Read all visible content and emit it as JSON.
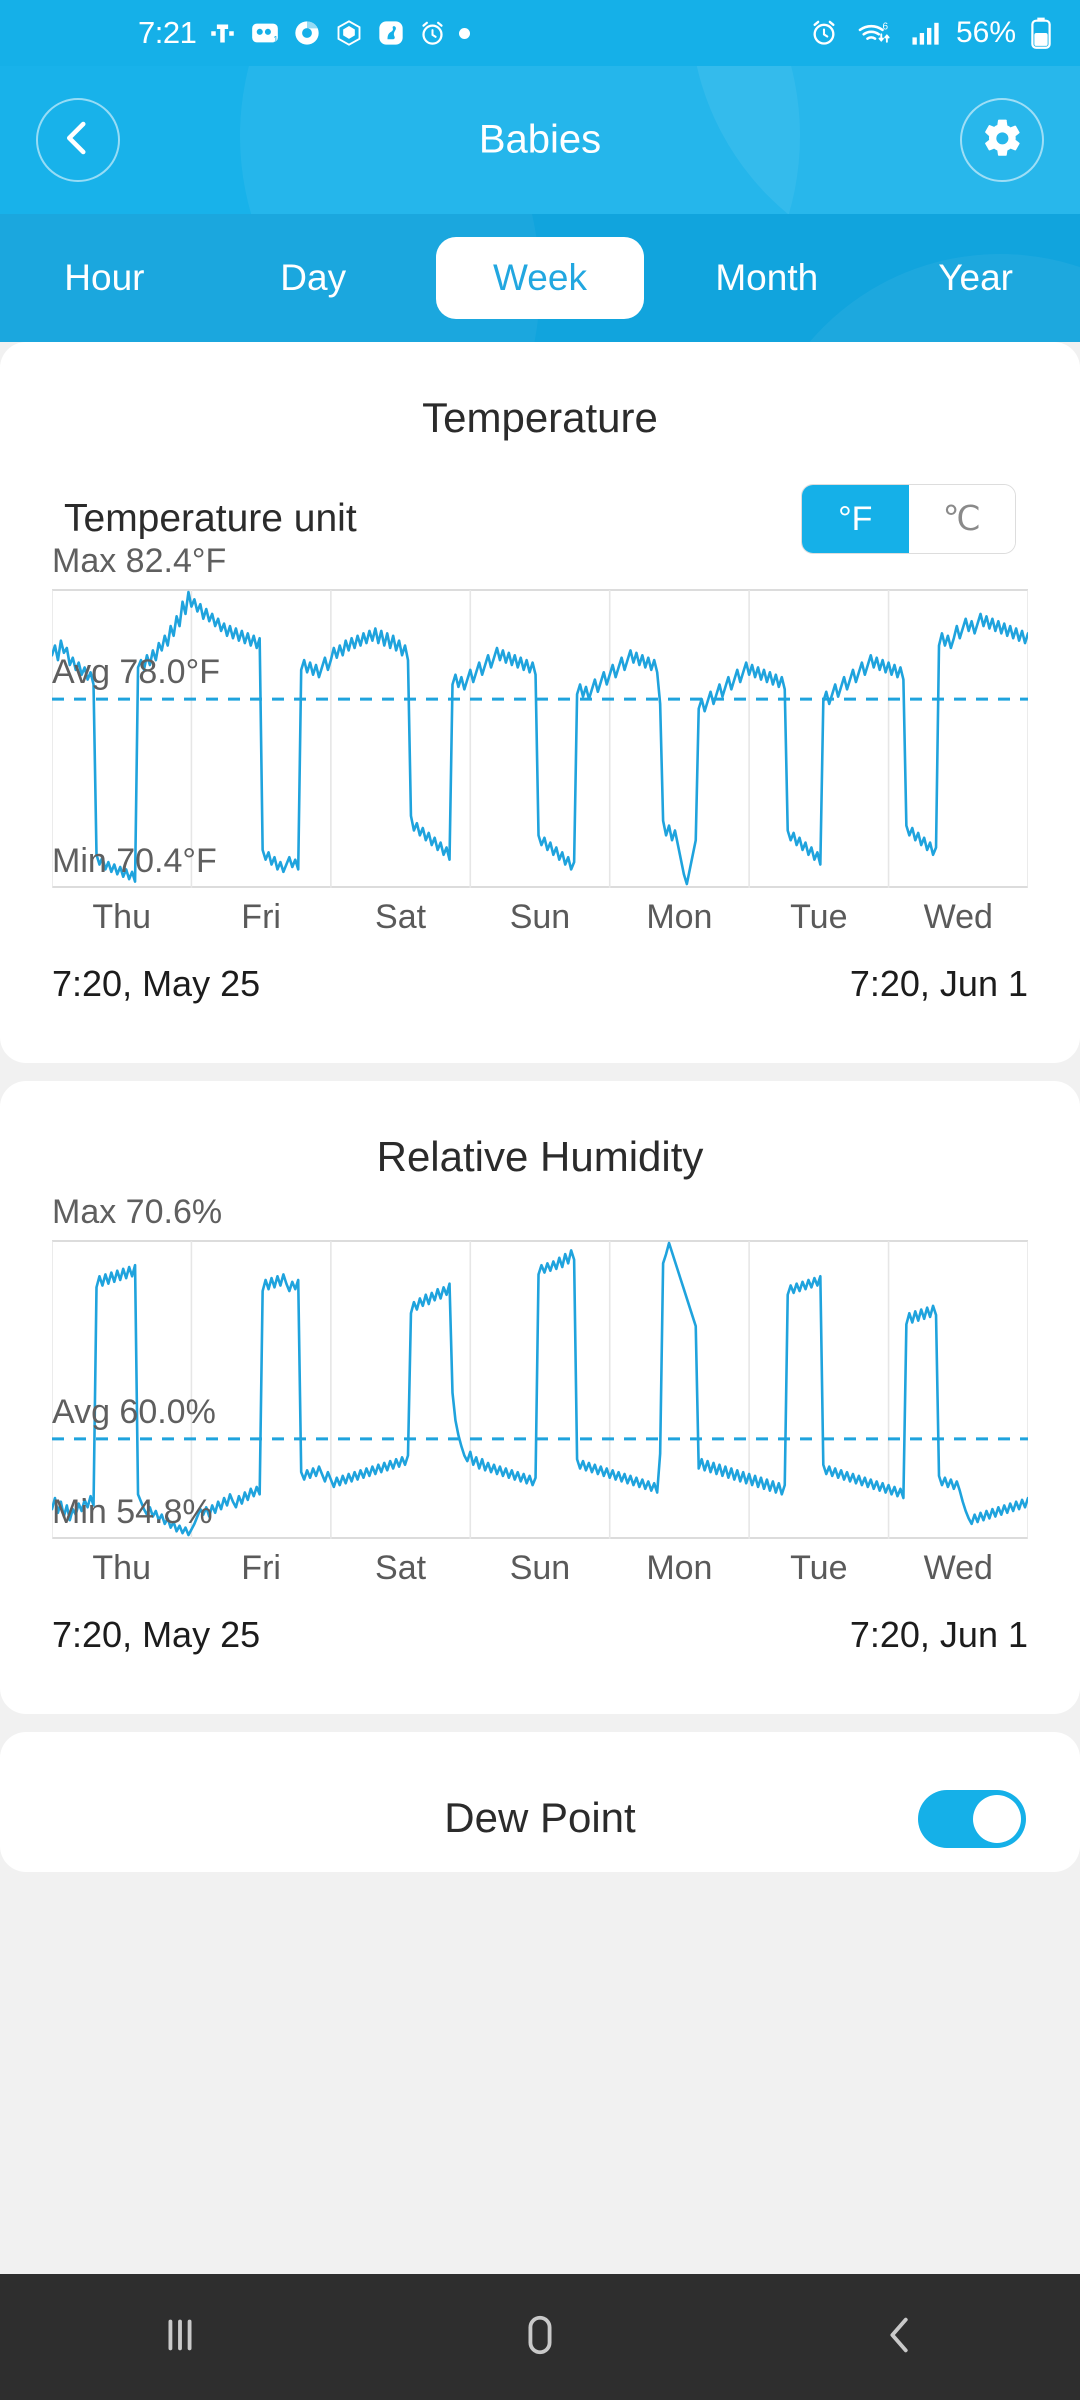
{
  "status_bar": {
    "time": "7:21",
    "carrier_icon": "t-mobile-icon",
    "icons": [
      "voicemail-icon",
      "chrome-icon",
      "crypto-icon",
      "squirrel-app-icon",
      "alarm-icon",
      "dot-indicator-icon"
    ],
    "alarm_icon": "alarm-icon",
    "wifi_icon": "wifi-icon",
    "signal_icon": "cellular-signal-icon",
    "battery_percent": "56%",
    "battery_icon": "battery-icon"
  },
  "app_bar": {
    "back_icon": "chevron-left-icon",
    "title": "Babies",
    "settings_icon": "gear-icon"
  },
  "tabs": [
    {
      "label": "Hour",
      "active": false
    },
    {
      "label": "Day",
      "active": false
    },
    {
      "label": "Week",
      "active": true
    },
    {
      "label": "Month",
      "active": false
    },
    {
      "label": "Year",
      "active": false
    }
  ],
  "temperature_card": {
    "title": "Temperature",
    "unit_label": "Temperature unit",
    "unit_fahrenheit": "°F",
    "unit_celsius": "℃",
    "selected_unit": "°F",
    "max_label": "Max 82.4°F",
    "avg_label": "Avg 78.0°F",
    "min_label": "Min 70.4°F",
    "start_datetime": "7:20,  May 25",
    "end_datetime": "7:20,  Jun 1"
  },
  "humidity_card": {
    "title": "Relative Humidity",
    "max_label": "Max 70.6%",
    "avg_label": "Avg 60.0%",
    "min_label": "Min 54.8%",
    "start_datetime": "7:20,  May 25",
    "end_datetime": "7:20,  Jun 1"
  },
  "dew_point_card": {
    "title": "Dew Point",
    "toggle_on": true
  },
  "nav_bar": {
    "recents_icon": "recents-icon",
    "home_icon": "home-icon",
    "back_icon": "back-icon"
  },
  "colors": {
    "accent": "#15b0e8",
    "header": "#18b2ea",
    "tabbar": "#11a4dd",
    "series": "#1fa3dd",
    "page_bg": "#f1f1f1",
    "navbar": "#2e2e2e"
  },
  "chart_data": [
    {
      "type": "line",
      "title": "Temperature",
      "xlabel": "",
      "ylabel": "°F",
      "ylim": [
        70.4,
        82.4
      ],
      "max": 82.4,
      "avg": 78.0,
      "min": 70.4,
      "unit": "°F",
      "grid": true,
      "legend": "none",
      "avg_line": 78.0,
      "categories": [
        "Thu",
        "Fri",
        "Sat",
        "Sun",
        "Mon",
        "Tue",
        "Wed"
      ],
      "x_start": "7:20,  May 25",
      "x_end": "7:20,  Jun 1",
      "values": [
        79.8,
        80.2,
        79.6,
        80.4,
        79.9,
        80.1,
        79.4,
        79.7,
        79.2,
        79.5,
        79.0,
        79.3,
        78.8,
        79.1,
        78.6,
        71.6,
        71.2,
        71.5,
        71.0,
        71.3,
        70.9,
        71.2,
        70.8,
        71.1,
        70.7,
        71.0,
        70.6,
        70.9,
        70.5,
        79.3,
        79.6,
        79.2,
        79.8,
        79.4,
        80.0,
        79.6,
        80.3,
        80.0,
        80.6,
        80.2,
        81.0,
        80.6,
        81.4,
        81.0,
        82.0,
        81.5,
        82.4,
        81.8,
        82.1,
        81.6,
        81.9,
        81.3,
        81.7,
        81.2,
        81.5,
        81.0,
        81.3,
        80.8,
        81.1,
        80.6,
        81.0,
        80.5,
        80.9,
        80.4,
        80.8,
        80.3,
        80.7,
        80.2,
        80.6,
        80.1,
        80.5,
        71.8,
        71.4,
        71.7,
        71.2,
        71.5,
        71.0,
        71.3,
        70.9,
        71.2,
        71.5,
        71.1,
        71.4,
        71.0,
        79.2,
        79.6,
        79.1,
        79.5,
        79.0,
        79.4,
        78.9,
        79.3,
        79.7,
        79.2,
        79.6,
        80.1,
        79.7,
        80.2,
        79.8,
        80.4,
        80.0,
        80.5,
        80.1,
        80.6,
        80.2,
        80.7,
        80.3,
        80.8,
        80.4,
        80.9,
        80.3,
        80.8,
        80.2,
        80.7,
        80.1,
        80.6,
        80.0,
        80.4,
        79.8,
        80.2,
        79.6,
        73.2,
        72.6,
        72.9,
        72.4,
        72.7,
        72.2,
        72.5,
        72.0,
        72.3,
        71.8,
        72.1,
        71.6,
        71.9,
        71.4,
        78.6,
        79.0,
        78.5,
        78.9,
        78.4,
        78.8,
        79.2,
        78.7,
        79.1,
        79.5,
        79.0,
        79.4,
        79.8,
        79.3,
        79.7,
        80.1,
        79.6,
        80.0,
        79.5,
        79.9,
        79.4,
        79.8,
        79.3,
        79.7,
        79.2,
        79.6,
        79.1,
        79.5,
        79.0,
        72.4,
        72.0,
        72.3,
        71.8,
        72.1,
        71.6,
        71.9,
        71.4,
        71.7,
        71.2,
        71.5,
        71.0,
        71.3,
        78.2,
        78.6,
        78.1,
        78.5,
        78.0,
        78.4,
        78.8,
        78.3,
        78.7,
        79.1,
        78.6,
        79.0,
        79.4,
        78.9,
        79.3,
        79.7,
        79.2,
        79.6,
        80.0,
        79.5,
        79.9,
        79.4,
        79.8,
        79.3,
        79.7,
        79.2,
        79.6,
        79.1,
        77.8,
        73.0,
        72.4,
        72.8,
        72.2,
        72.6,
        72.0,
        71.4,
        70.8,
        70.4,
        71.0,
        71.6,
        72.2,
        77.6,
        78.0,
        77.5,
        77.9,
        78.3,
        77.8,
        78.2,
        78.6,
        78.1,
        78.5,
        78.9,
        78.4,
        78.8,
        79.2,
        78.7,
        79.1,
        79.5,
        79.0,
        79.4,
        78.9,
        79.3,
        78.8,
        79.2,
        78.7,
        79.1,
        78.6,
        79.0,
        78.5,
        78.9,
        78.4,
        72.6,
        72.2,
        72.5,
        72.0,
        72.3,
        71.8,
        72.1,
        71.6,
        71.9,
        71.4,
        71.7,
        71.2,
        77.9,
        78.3,
        77.8,
        78.2,
        78.6,
        78.1,
        78.5,
        78.9,
        78.4,
        78.8,
        79.2,
        78.7,
        79.1,
        79.5,
        79.0,
        79.4,
        79.8,
        79.3,
        79.7,
        79.2,
        79.6,
        79.1,
        79.5,
        79.0,
        79.4,
        78.9,
        79.3,
        78.8,
        72.8,
        72.4,
        72.7,
        72.2,
        72.5,
        72.0,
        72.3,
        71.8,
        72.1,
        71.6,
        71.9,
        80.2,
        80.7,
        80.2,
        80.6,
        80.1,
        80.5,
        81.0,
        80.5,
        80.9,
        81.3,
        80.8,
        81.2,
        80.7,
        81.1,
        81.5,
        81.0,
        81.4,
        80.9,
        81.3,
        80.8,
        81.2,
        80.7,
        81.1,
        80.6,
        81.0,
        80.5,
        80.9,
        80.4,
        80.8,
        80.3,
        80.7
      ]
    },
    {
      "type": "line",
      "title": "Relative Humidity",
      "xlabel": "",
      "ylabel": "%",
      "ylim": [
        54.8,
        70.6
      ],
      "max": 70.6,
      "avg": 60.0,
      "min": 54.8,
      "unit": "%",
      "grid": true,
      "legend": "none",
      "avg_line": 60.0,
      "categories": [
        "Thu",
        "Fri",
        "Sat",
        "Sun",
        "Mon",
        "Tue",
        "Wed"
      ],
      "x_start": "7:20,  May 25",
      "x_end": "7:20,  Jun 1",
      "values": [
        56.2,
        56.8,
        56.0,
        56.6,
        55.8,
        56.4,
        55.6,
        56.2,
        55.9,
        56.5,
        56.1,
        56.7,
        56.3,
        56.9,
        56.4,
        68.2,
        68.8,
        68.3,
        68.9,
        68.4,
        69.0,
        68.5,
        69.1,
        68.6,
        69.2,
        68.7,
        69.3,
        68.8,
        69.4,
        57.0,
        56.6,
        56.2,
        55.9,
        56.3,
        55.8,
        56.1,
        55.6,
        55.9,
        55.4,
        55.7,
        55.2,
        55.5,
        55.0,
        55.3,
        54.9,
        55.2,
        54.8,
        55.1,
        55.4,
        55.8,
        56.2,
        55.9,
        56.3,
        55.8,
        56.4,
        56.0,
        56.6,
        56.2,
        56.8,
        56.4,
        57.0,
        56.6,
        56.3,
        56.9,
        56.5,
        57.1,
        56.7,
        57.3,
        56.9,
        57.4,
        57.0,
        68.0,
        68.6,
        68.1,
        68.7,
        68.2,
        68.8,
        68.3,
        68.9,
        68.4,
        68.0,
        68.5,
        68.1,
        68.6,
        58.2,
        57.8,
        58.3,
        57.9,
        58.4,
        58.0,
        58.5,
        58.1,
        57.7,
        58.2,
        57.8,
        57.4,
        57.9,
        57.5,
        58.0,
        57.6,
        58.1,
        57.7,
        58.2,
        57.8,
        58.3,
        57.9,
        58.4,
        58.0,
        58.5,
        58.1,
        58.6,
        58.2,
        58.7,
        58.3,
        58.8,
        58.4,
        58.9,
        58.5,
        59.0,
        58.6,
        59.1,
        66.8,
        67.4,
        67.0,
        67.6,
        67.2,
        67.8,
        67.3,
        67.9,
        67.5,
        68.1,
        67.6,
        68.2,
        67.8,
        68.4,
        62.5,
        61.0,
        60.2,
        59.6,
        59.1,
        58.8,
        59.3,
        58.6,
        59.0,
        58.4,
        58.9,
        58.3,
        58.7,
        58.2,
        58.6,
        58.1,
        58.5,
        58.0,
        58.4,
        57.9,
        58.3,
        57.8,
        58.2,
        57.7,
        58.1,
        57.6,
        58.0,
        57.5,
        57.9,
        68.9,
        69.4,
        69.0,
        69.5,
        69.1,
        69.6,
        69.2,
        69.8,
        69.3,
        70.0,
        69.5,
        70.2,
        69.7,
        58.9,
        58.4,
        58.8,
        58.3,
        58.7,
        58.2,
        58.6,
        58.1,
        58.5,
        58.0,
        58.4,
        57.9,
        58.3,
        57.8,
        58.2,
        57.7,
        58.1,
        57.6,
        58.0,
        57.5,
        57.9,
        57.4,
        57.8,
        57.3,
        57.7,
        57.2,
        57.6,
        57.1,
        59.2,
        69.5,
        70.0,
        70.6,
        70.1,
        69.6,
        69.1,
        68.6,
        68.1,
        67.6,
        67.1,
        66.6,
        66.1,
        58.4,
        58.9,
        58.3,
        58.8,
        58.2,
        58.7,
        58.1,
        58.6,
        58.0,
        58.5,
        57.9,
        58.4,
        57.8,
        58.3,
        57.7,
        58.2,
        57.6,
        58.1,
        57.5,
        58.0,
        57.4,
        57.9,
        57.3,
        57.8,
        57.2,
        57.7,
        57.1,
        57.6,
        57.0,
        57.5,
        67.8,
        68.3,
        67.9,
        68.4,
        68.0,
        68.5,
        68.1,
        68.6,
        68.2,
        68.7,
        68.3,
        68.8,
        58.6,
        58.1,
        58.5,
        58.0,
        58.4,
        57.9,
        58.3,
        57.8,
        58.2,
        57.7,
        58.1,
        57.6,
        58.0,
        57.5,
        57.9,
        57.4,
        57.8,
        57.3,
        57.7,
        57.2,
        57.6,
        57.1,
        57.5,
        57.0,
        57.4,
        56.9,
        57.3,
        56.8,
        66.2,
        66.8,
        66.3,
        66.9,
        66.4,
        67.0,
        66.5,
        67.1,
        66.6,
        67.2,
        66.7,
        58.0,
        57.5,
        57.9,
        57.4,
        57.8,
        57.3,
        57.7,
        57.2,
        56.6,
        56.1,
        55.7,
        55.4,
        55.9,
        55.5,
        56.0,
        55.6,
        56.1,
        55.7,
        56.2,
        55.8,
        56.3,
        55.9,
        56.4,
        56.0,
        56.5,
        56.1,
        56.6,
        56.2,
        56.7,
        56.3,
        56.8
      ]
    }
  ]
}
